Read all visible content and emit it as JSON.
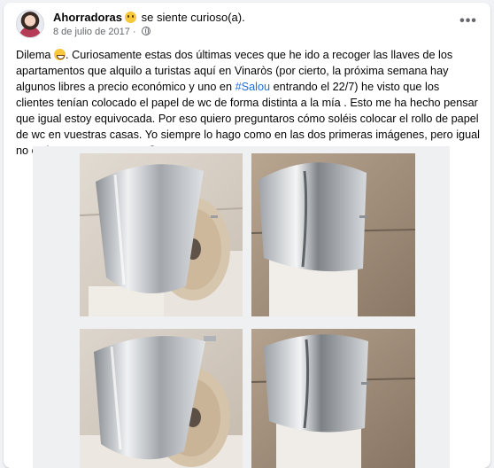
{
  "post": {
    "author": "Ahorradoras",
    "feeling_text": " se siente curioso(a).",
    "feeling_icon": "curious-face-emoji",
    "date": "8 de julio de 2017",
    "date_separator": " · ",
    "privacy_icon": "globe-icon",
    "more_icon": "more-options-icon",
    "more_label": "•••"
  },
  "body_text": {
    "part1": "Dilema ",
    "emoji": "grinning-face-emoji",
    "part2": ". Curiosamente estas dos últimas veces que he ido a recoger las llaves de los apartamentos que alquilo a turistas aquí en Vinaròs (por cierto, la próxima semana hay algunos libres a precio económico y uno en ",
    "hashtag": "#Salou",
    "part3": " entrando el 22/7) he visto que los clientes tenían colocado el papel de wc de forma distinta a la mía . Esto me ha hecho pensar que igual estoy equivocada. Por eso quiero preguntaros cómo soléis colocar el rollo de papel de wc en vuestras casas. Yo siempre lo hago como en las dos primeras imágenes, pero igual no es lo correcto. Y vosotr@s?"
  },
  "photos": [
    {
      "name": "photo-roll-over-1",
      "kind": "over"
    },
    {
      "name": "photo-roll-under-1",
      "kind": "under"
    },
    {
      "name": "photo-roll-over-2",
      "kind": "over"
    },
    {
      "name": "photo-roll-under-2",
      "kind": "under"
    }
  ],
  "colors": {
    "hashtag": "#216fdb",
    "secondary_text": "#65676b",
    "wall_tile": "#cfc5b8",
    "chrome": "#c9ccd0",
    "paper": "#f2efe9"
  }
}
